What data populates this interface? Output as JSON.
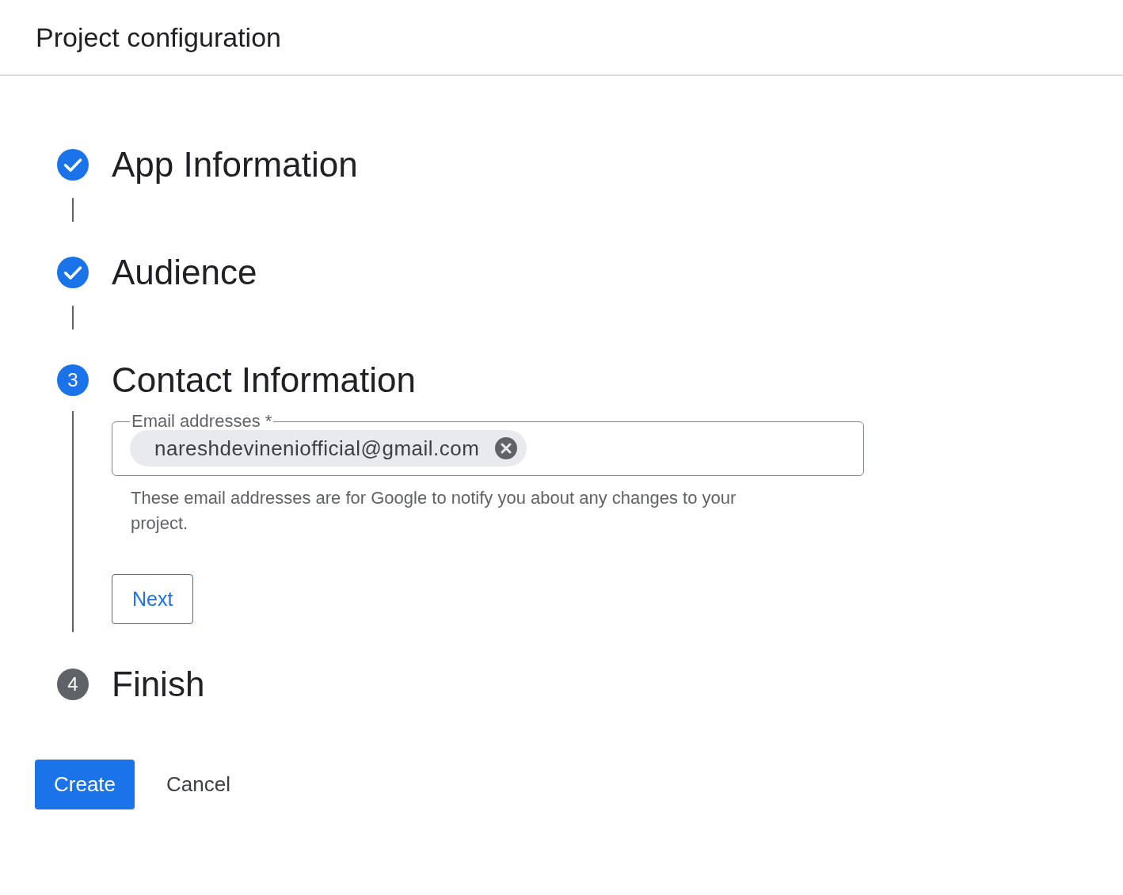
{
  "header": {
    "title": "Project configuration"
  },
  "steps": [
    {
      "label": "App Information",
      "kind": "done"
    },
    {
      "label": "Audience",
      "kind": "done"
    },
    {
      "label": "Contact Information",
      "kind": "active",
      "number": "3"
    },
    {
      "label": "Finish",
      "kind": "pending",
      "number": "4"
    }
  ],
  "contact_form": {
    "field_label": "Email addresses *",
    "chips": [
      {
        "text": "nareshdevineniofficial@gmail.com"
      }
    ],
    "helper": "These email addresses are for Google to notify you about any changes to your project.",
    "next_button": "Next"
  },
  "actions": {
    "create": "Create",
    "cancel": "Cancel"
  }
}
